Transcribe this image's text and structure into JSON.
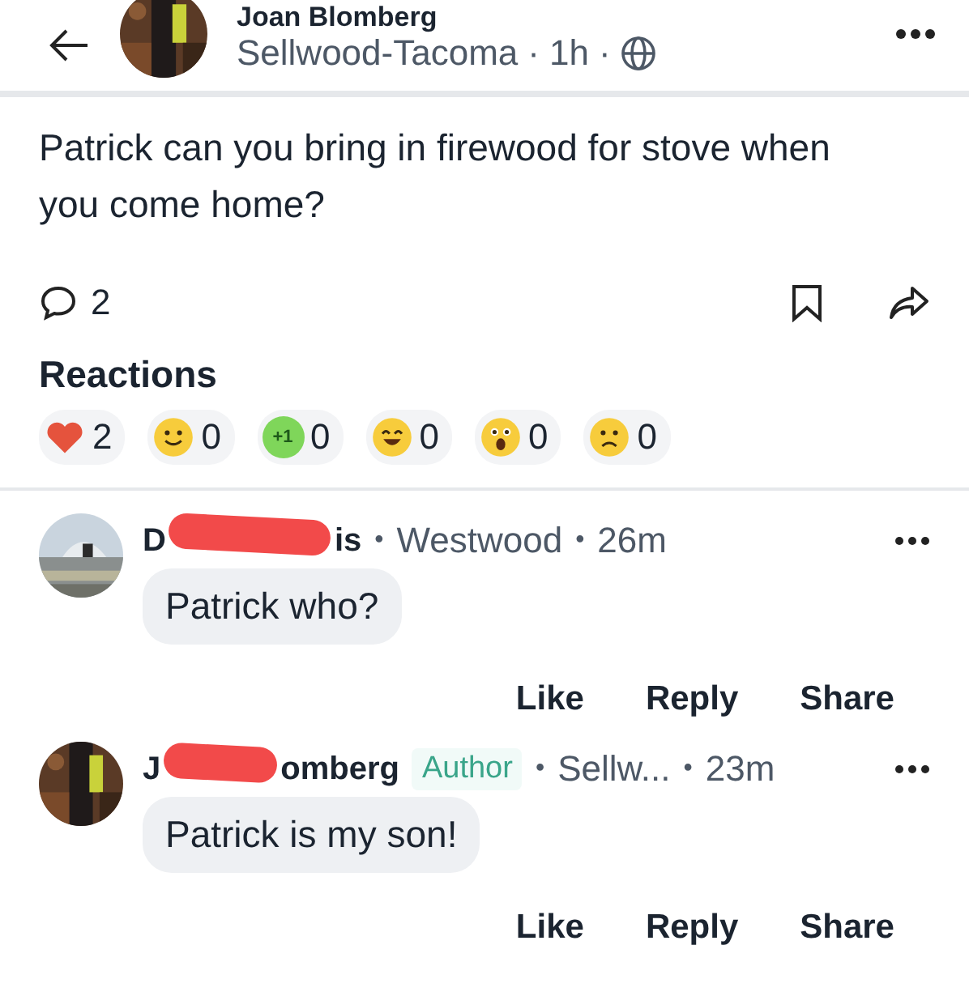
{
  "post": {
    "author": "Joan Blomberg",
    "place": "Sellwood-Tacoma",
    "sep1": "·",
    "time": "1h",
    "sep2": "·",
    "body": "Patrick can you bring in firewood for stove when you come home?",
    "comment_count": "2",
    "reactions_title": "Reactions",
    "reactions": [
      {
        "kind": "heart",
        "count": "2"
      },
      {
        "kind": "smile",
        "count": "0"
      },
      {
        "kind": "plus-one",
        "badge": "+1",
        "count": "0"
      },
      {
        "kind": "laugh",
        "count": "0"
      },
      {
        "kind": "wow",
        "count": "0"
      },
      {
        "kind": "sad",
        "count": "0"
      }
    ]
  },
  "comments": [
    {
      "name_start": "D",
      "name_end": "is",
      "author": false,
      "sep1": "•",
      "place": "Westwood",
      "sep2": "•",
      "time": "26m",
      "text": "Patrick who?",
      "actions": [
        "Like",
        "Reply",
        "Share"
      ]
    },
    {
      "name_start": "J",
      "name_end": "omberg",
      "author": true,
      "author_label": "Author",
      "sep1": "•",
      "place": "Sellw...",
      "sep2": "•",
      "time": "23m",
      "text": "Patrick is my son!",
      "actions": [
        "Like",
        "Reply",
        "Share"
      ]
    }
  ]
}
